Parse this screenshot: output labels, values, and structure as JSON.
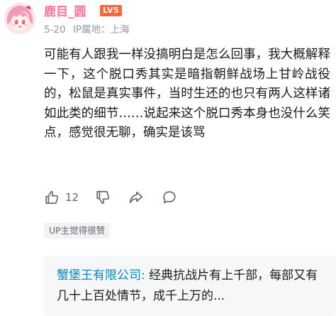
{
  "comment": {
    "username": "鹿目_圆",
    "level": "LV5",
    "date": "5-20",
    "ip_location": "IP属地：上海",
    "text": "可能有人跟我一样没搞明白是怎么回事，我大概解释一下，这个脱口秀其实是暗指朝鲜战场上甘岭战役的，松鼠是真实事件，当时生还的也只有两人这样诸如此类的细节……说起来这个脱口秀本身也没什么笑点，感觉很无聊，确实是该骂",
    "like_count": "12",
    "up_tag": "UP主觉得很赞"
  },
  "reply": {
    "username": "蟹堡王有限公司:",
    "text": " 经典抗战片有上千部，每部又有几十上百处情节，成千上万的..."
  },
  "icons": {
    "avatar": "anime-girl-avatar",
    "like": "thumbs-up-icon",
    "dislike": "thumbs-down-icon",
    "share": "share-icon",
    "comment": "comment-icon"
  },
  "colors": {
    "username": "#fb7299",
    "level_badge": "#ff6633",
    "reply_username": "#008ac5",
    "meta": "#9499a0"
  }
}
